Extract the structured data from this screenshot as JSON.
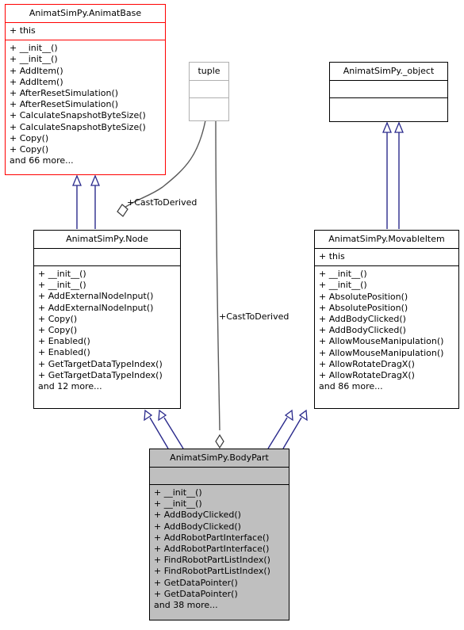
{
  "diagram": {
    "kind": "uml-inheritance-graph",
    "colors": {
      "base_border": "#ff0000",
      "external_border": "#b0b0b0",
      "default_border": "#000000",
      "highlight_fill": "#bfbfbf",
      "inheritance_edge": "#2a2a8c",
      "usage_edge": "#5a5a5a"
    },
    "classes": [
      {
        "id": "animatbase",
        "title": "AnimatSimPy.AnimatBase",
        "attributes": [
          "+ this"
        ],
        "operations": [
          "+ __init__()",
          "+ __init__()",
          "+ AddItem()",
          "+ AddItem()",
          "+ AfterResetSimulation()",
          "+ AfterResetSimulation()",
          "+ CalculateSnapshotByteSize()",
          "+ CalculateSnapshotByteSize()",
          "+ Copy()",
          "+ Copy()",
          "and 66 more..."
        ]
      },
      {
        "id": "tuple",
        "title": "tuple",
        "attributes": [],
        "operations": []
      },
      {
        "id": "object",
        "title": "AnimatSimPy._object",
        "attributes": [],
        "operations": []
      },
      {
        "id": "node",
        "title": "AnimatSimPy.Node",
        "attributes": [],
        "operations": [
          "+ __init__()",
          "+ __init__()",
          "+ AddExternalNodeInput()",
          "+ AddExternalNodeInput()",
          "+ Copy()",
          "+ Copy()",
          "+ Enabled()",
          "+ Enabled()",
          "+ GetTargetDataTypeIndex()",
          "+ GetTargetDataTypeIndex()",
          "and 12 more..."
        ]
      },
      {
        "id": "movableitem",
        "title": "AnimatSimPy.MovableItem",
        "attributes": [
          "+ this"
        ],
        "operations": [
          "+ __init__()",
          "+ __init__()",
          "+ AbsolutePosition()",
          "+ AbsolutePosition()",
          "+ AddBodyClicked()",
          "+ AddBodyClicked()",
          "+ AllowMouseManipulation()",
          "+ AllowMouseManipulation()",
          "+ AllowRotateDragX()",
          "+ AllowRotateDragX()",
          "and 86 more..."
        ]
      },
      {
        "id": "bodypart",
        "title": "AnimatSimPy.BodyPart",
        "attributes": [],
        "operations": [
          "+ __init__()",
          "+ __init__()",
          "+ AddBodyClicked()",
          "+ AddBodyClicked()",
          "+ AddRobotPartInterface()",
          "+ AddRobotPartInterface()",
          "+ FindRobotPartListIndex()",
          "+ FindRobotPartListIndex()",
          "+ GetDataPointer()",
          "+ GetDataPointer()",
          "and 38 more..."
        ]
      }
    ],
    "edge_labels": [
      {
        "id": "cast-node",
        "text": "+CastToDerived"
      },
      {
        "id": "cast-bodypart",
        "text": "+CastToDerived"
      }
    ]
  }
}
